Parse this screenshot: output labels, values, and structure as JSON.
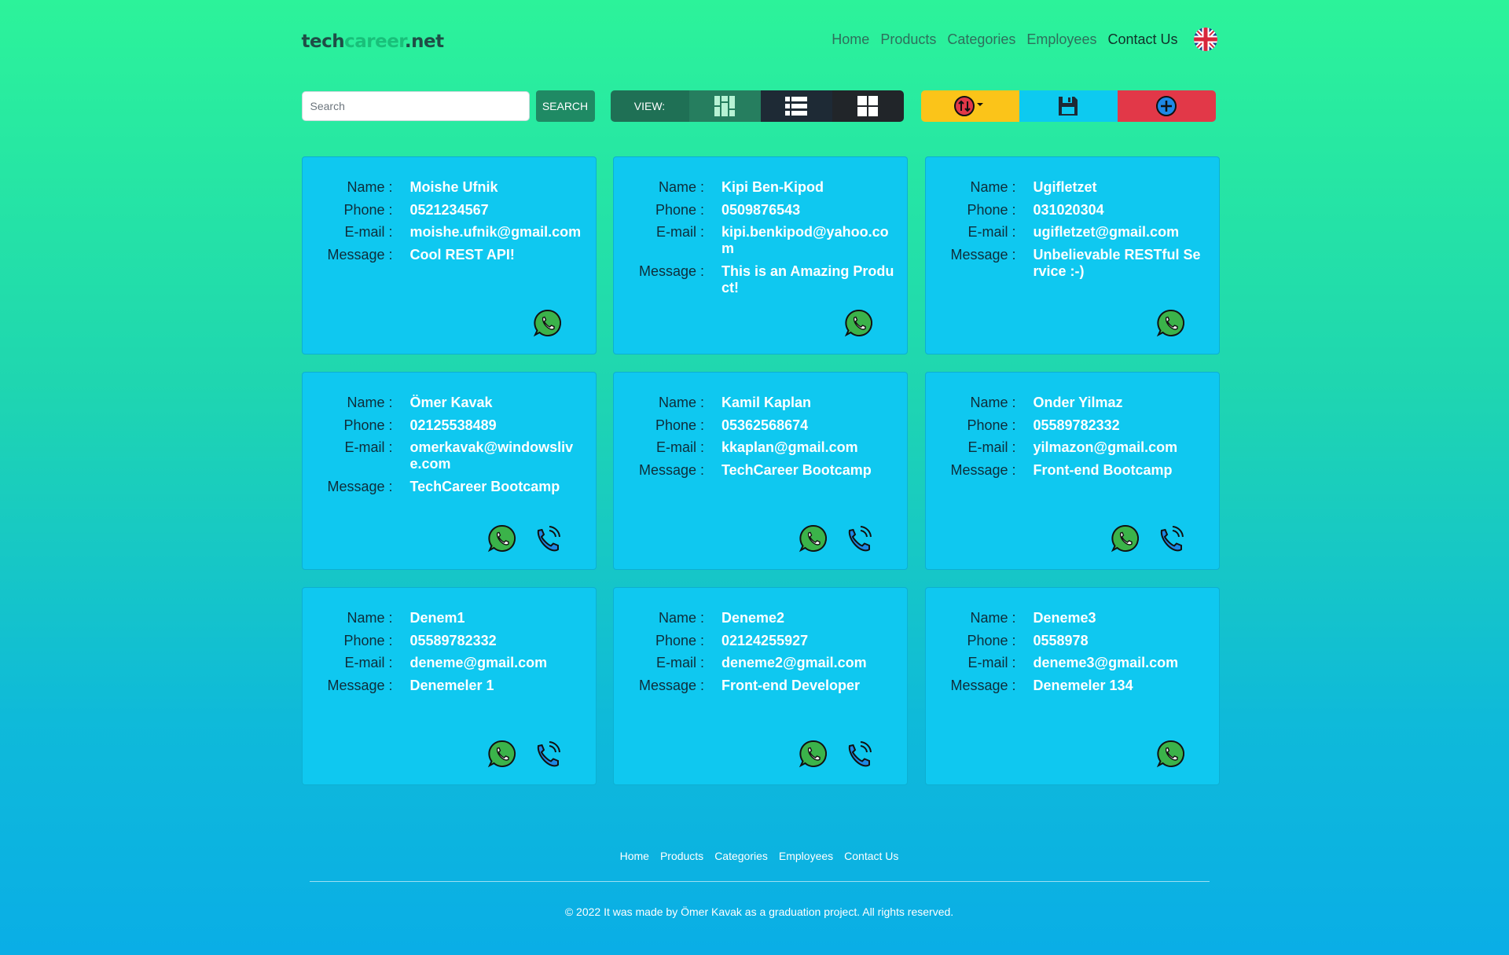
{
  "brand": {
    "part1": "tech",
    "part2": "career",
    "part3": ".net"
  },
  "nav": {
    "home": "Home",
    "products": "Products",
    "categories": "Categories",
    "employees": "Employees",
    "contact": "Contact Us"
  },
  "toolbar": {
    "search_placeholder": "Search",
    "search_label": "SEARCH",
    "view_label": "VIEW:"
  },
  "labels": {
    "name": "Name :",
    "phone": "Phone :",
    "email": "E-mail :",
    "message": "Message :"
  },
  "contacts": [
    {
      "name": "Moishe Ufnik",
      "phone": "0521234567",
      "email": "moishe.ufnik@gmail.com",
      "message": "Cool REST API!"
    },
    {
      "name": "Kipi Ben-Kipod",
      "phone": "0509876543",
      "email": "kipi.benkipod@yahoo.com",
      "message": "This is an Amazing Product!"
    },
    {
      "name": "Ugifletzet",
      "phone": "031020304",
      "email": "ugifletzet@gmail.com",
      "message": "Unbelievable RESTful Service :-)"
    },
    {
      "name": "Ömer Kavak",
      "phone": "02125538489",
      "email": "omerkavak@windowslive.com",
      "message": "TechCareer Bootcamp"
    },
    {
      "name": "Kamil Kaplan",
      "phone": "05362568674",
      "email": "kkaplan@gmail.com",
      "message": "TechCareer Bootcamp"
    },
    {
      "name": "Onder Yilmaz",
      "phone": "05589782332",
      "email": "yilmazon@gmail.com",
      "message": "Front-end Bootcamp"
    },
    {
      "name": "Denem1",
      "phone": "05589782332",
      "email": "deneme@gmail.com",
      "message": "Denemeler 1"
    },
    {
      "name": "Deneme2",
      "phone": "02124255927",
      "email": "deneme2@gmail.com",
      "message": "Front-end Developer"
    },
    {
      "name": "Deneme3",
      "phone": "0558978",
      "email": "deneme3@gmail.com",
      "message": "Denemeler 134"
    }
  ],
  "footer": {
    "home": "Home",
    "products": "Products",
    "categories": "Categories",
    "employees": "Employees",
    "contact": "Contact Us",
    "copyright": "© 2022 It was made by Ömer Kavak as a graduation project. All rights reserved."
  },
  "colors": {
    "sort": "#fbc419",
    "save": "#0dcaf0",
    "add": "#e23848",
    "card": "#0fc8f0",
    "search_button": "#1f8a64"
  }
}
